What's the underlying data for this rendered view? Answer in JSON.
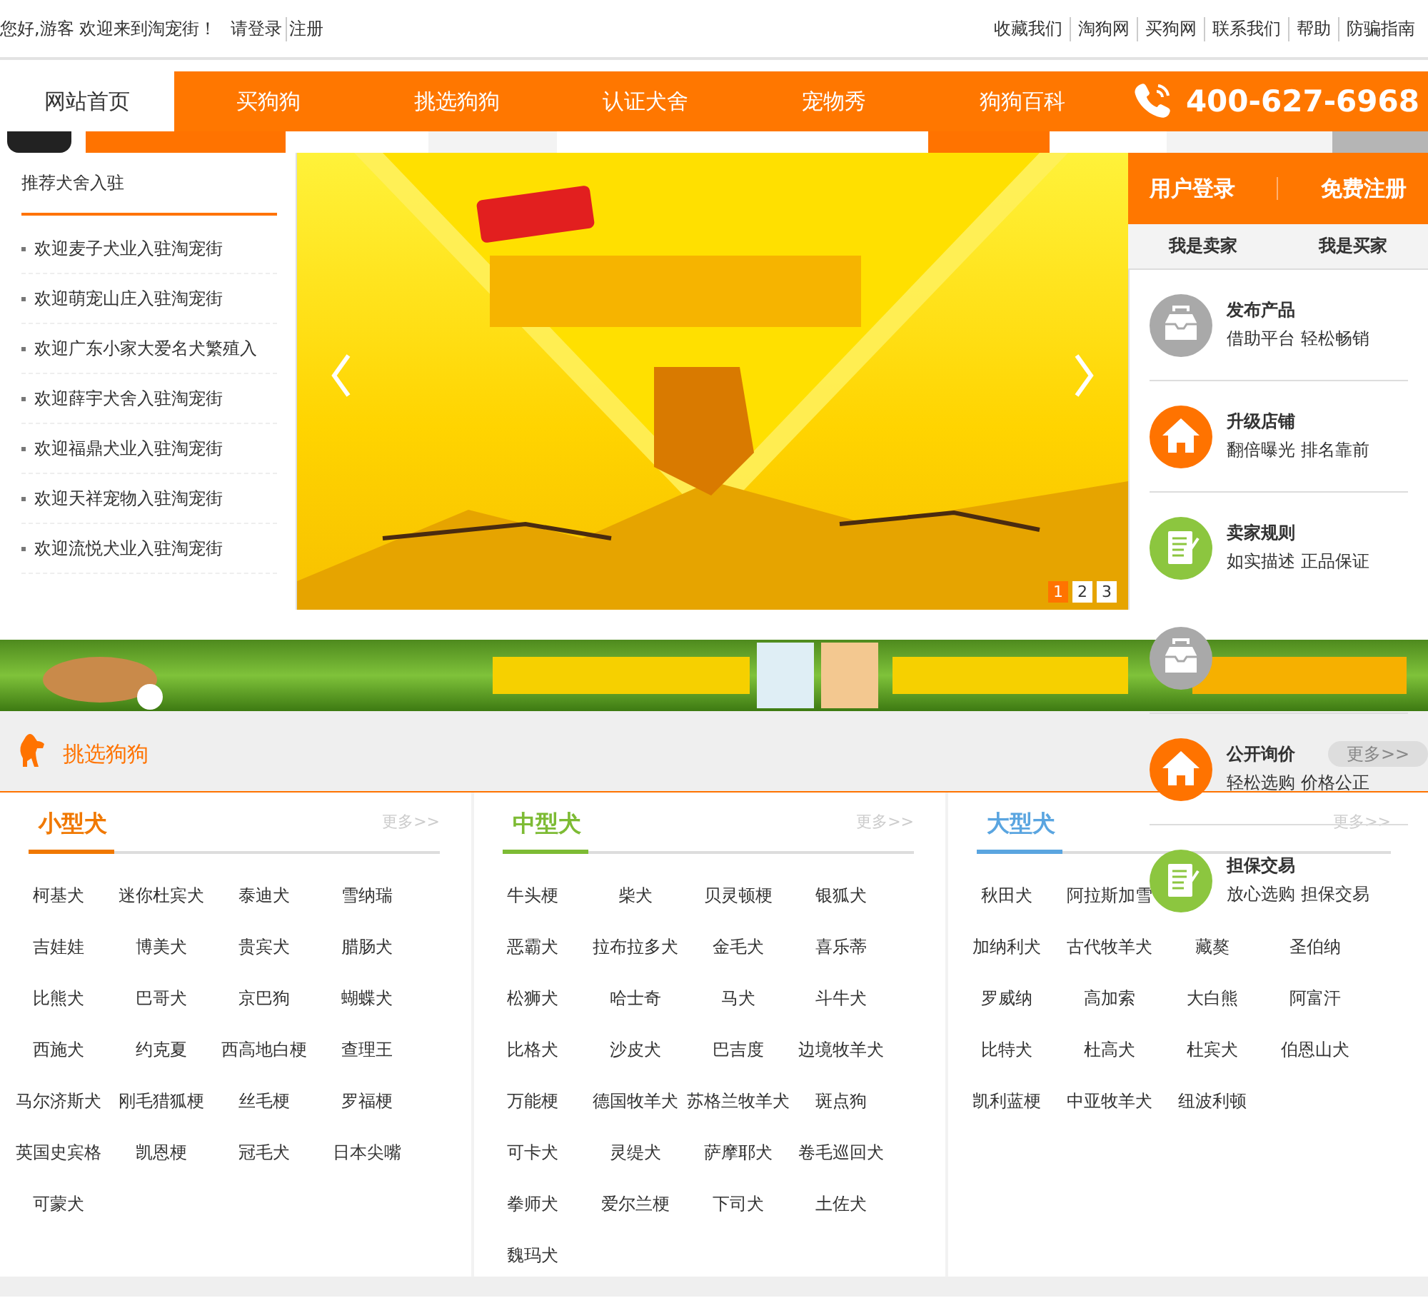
{
  "top_bar": {
    "greeting": "您好,游客 欢迎来到淘宠街！",
    "login": "请登录",
    "register": "注册",
    "links": [
      "收藏我们",
      "淘狗网",
      "买狗网",
      "联系我们",
      "帮助",
      "防骗指南"
    ]
  },
  "nav": {
    "items": [
      {
        "label": "网站首页",
        "selected": true
      },
      {
        "label": "买狗狗",
        "selected": false
      },
      {
        "label": "挑选狗狗",
        "selected": false
      },
      {
        "label": "认证犬舍",
        "selected": false
      },
      {
        "label": "宠物秀",
        "selected": false
      },
      {
        "label": "狗狗百科",
        "selected": false
      }
    ],
    "phone": "400-627-6968"
  },
  "recommend": {
    "title": "推荐犬舍入驻",
    "items": [
      "欢迎麦子犬业入驻淘宠街",
      "欢迎萌宠山庄入驻淘宠街",
      "欢迎广东小家大爱名犬繁殖入",
      "欢迎薛宇犬舍入驻淘宠街",
      "欢迎福鼎犬业入驻淘宠街",
      "欢迎天祥宠物入驻淘宠街",
      "欢迎流悦犬业入驻淘宠街"
    ]
  },
  "slider": {
    "pages": [
      {
        "label": "1",
        "selected": true
      },
      {
        "label": "2",
        "selected": false
      },
      {
        "label": "3",
        "selected": false
      }
    ]
  },
  "user_panel": {
    "login": "用户登录",
    "register": "免费注册",
    "tabs": [
      "我是卖家",
      "我是买家"
    ],
    "items": [
      {
        "kind": "box",
        "title": "发布产品",
        "subtitle": "借助平台 轻松畅销"
      },
      {
        "kind": "house",
        "title": "升级店铺",
        "subtitle": "翻倍曝光 排名靠前"
      },
      {
        "kind": "notepad",
        "title": "卖家规则",
        "subtitle": "如实描述 正品保证"
      },
      {
        "kind": "box"
      },
      {
        "kind": "house",
        "title": "公开询价",
        "subtitle": "轻松选购 价格公正"
      },
      {
        "kind": "notepad",
        "title": "担保交易",
        "subtitle": "放心选购 担保交易"
      }
    ]
  },
  "section": {
    "title": "挑选狗狗",
    "more": "更多>>"
  },
  "breed_groups": [
    {
      "title": "小型犬",
      "color": "#f07800",
      "more": "更多>>",
      "rows": [
        [
          "柯基犬",
          "迷你杜宾犬",
          "泰迪犬",
          "雪纳瑞"
        ],
        [
          "吉娃娃",
          "博美犬",
          "贵宾犬",
          "腊肠犬"
        ],
        [
          "比熊犬",
          "巴哥犬",
          "京巴狗",
          "蝴蝶犬"
        ],
        [
          "西施犬",
          "约克夏",
          "西高地白梗",
          "查理王"
        ],
        [
          "马尔济斯犬",
          "刚毛猎狐梗",
          "丝毛梗",
          "罗福梗"
        ],
        [
          "英国史宾格",
          "凯恩梗",
          "冠毛犬",
          "日本尖嘴"
        ],
        [
          "可蒙犬"
        ]
      ]
    },
    {
      "title": "中型犬",
      "color": "#7dbb34",
      "more": "更多>>",
      "rows": [
        [
          "牛头梗",
          "柴犬",
          "贝灵顿梗",
          "银狐犬"
        ],
        [
          "恶霸犬",
          "拉布拉多犬",
          "金毛犬",
          "喜乐蒂"
        ],
        [
          "松狮犬",
          "哈士奇",
          "马犬",
          "斗牛犬"
        ],
        [
          "比格犬",
          "沙皮犬",
          "巴吉度",
          "边境牧羊犬"
        ],
        [
          "万能梗",
          "德国牧羊犬",
          "苏格兰牧羊犬",
          "斑点狗"
        ],
        [
          "可卡犬",
          "灵缇犬",
          "萨摩耶犬",
          "卷毛巡回犬"
        ],
        [
          "拳师犬",
          "爱尔兰梗",
          "下司犬",
          "土佐犬"
        ],
        [
          "魏玛犬"
        ]
      ]
    },
    {
      "title": "大型犬",
      "color": "#5aa5e0",
      "more": "更多>>",
      "rows": [
        [
          "秋田犬",
          "阿拉斯加雪"
        ],
        [
          "加纳利犬",
          "古代牧羊犬",
          "藏獒",
          "圣伯纳"
        ],
        [
          "罗威纳",
          "高加索",
          "大白熊",
          "阿富汗"
        ],
        [
          "比特犬",
          "杜高犬",
          "杜宾犬",
          "伯恩山犬"
        ],
        [
          "凯利蓝梗",
          "中亚牧羊犬",
          "纽波利顿"
        ]
      ]
    }
  ]
}
